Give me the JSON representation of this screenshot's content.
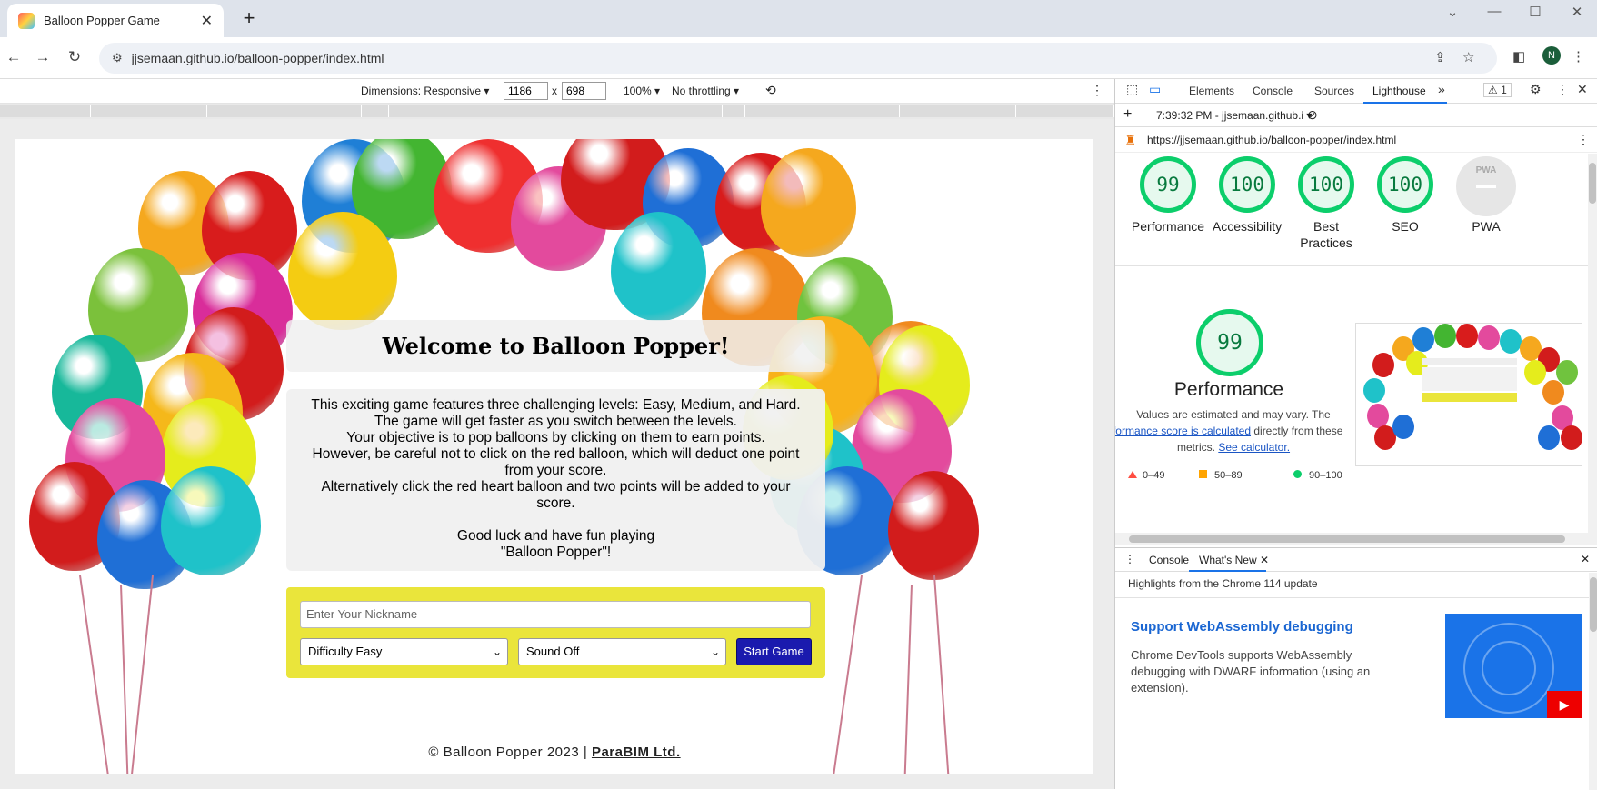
{
  "browser": {
    "tab_title": "Balloon Popper Game",
    "url": "jjsemaan.github.io/balloon-popper/index.html",
    "profile_initial": "N"
  },
  "emulation": {
    "dimensions_label": "Dimensions: Responsive",
    "width": "1186",
    "times": "x",
    "height": "698",
    "zoom": "100%",
    "throttling": "No throttling"
  },
  "page": {
    "heading": "Welcome to Balloon Popper!",
    "info_lines": [
      "This exciting game features three challenging levels: Easy, Medium, and Hard.",
      "The game will get faster as you switch between the levels.",
      "Your objective is to pop balloons by clicking on them to earn points.",
      "However, be careful not to click on the red balloon, which will deduct one point",
      "from your score.",
      "Alternatively click the red heart balloon and two points will be added to your",
      "score.",
      "",
      "Good luck and have fun playing",
      "\"Balloon Popper\"!"
    ],
    "nickname_placeholder": "Enter Your Nickname",
    "difficulty_value": "Difficulty Easy",
    "sound_value": "Sound Off",
    "start_button": "Start Game",
    "footer_text": "© Balloon Popper 2023 | ",
    "footer_link": "ParaBIM Ltd."
  },
  "devtools": {
    "tabs": [
      "Elements",
      "Console",
      "Sources",
      "Lighthouse"
    ],
    "active_tab": "Lighthouse",
    "warning_count": "1",
    "report_time": "7:39:32 PM - jjsemaan.github.i",
    "report_url": "https://jjsemaan.github.io/balloon-popper/index.html",
    "scores": [
      {
        "label": "Performance",
        "value": "99"
      },
      {
        "label": "Accessibility",
        "value": "100"
      },
      {
        "label": "Best Practices",
        "value": "100"
      },
      {
        "label": "SEO",
        "value": "100"
      }
    ],
    "pwa_label": "PWA",
    "pwa_badge": "PWA",
    "perf_score": "99",
    "perf_title": "Performance",
    "perf_note_1": "Values are estimated and may vary. The",
    "perf_note_link": "performance score is calculated",
    "perf_note_2": " directly from these",
    "perf_note_3": "metrics. ",
    "perf_note_link2": "See calculator.",
    "legend": [
      "0–49",
      "50–89",
      "90–100"
    ],
    "colors": {
      "pass": "#0cce6b",
      "average": "#ffa400",
      "fail": "#ff4e42"
    },
    "drawer_tabs": [
      "Console",
      "What's New"
    ],
    "drawer_header": "Highlights from the Chrome 114 update",
    "news_title": "Support WebAssembly debugging",
    "news_body": "Chrome DevTools supports WebAssembly debugging with DWARF information (using an extension)."
  }
}
